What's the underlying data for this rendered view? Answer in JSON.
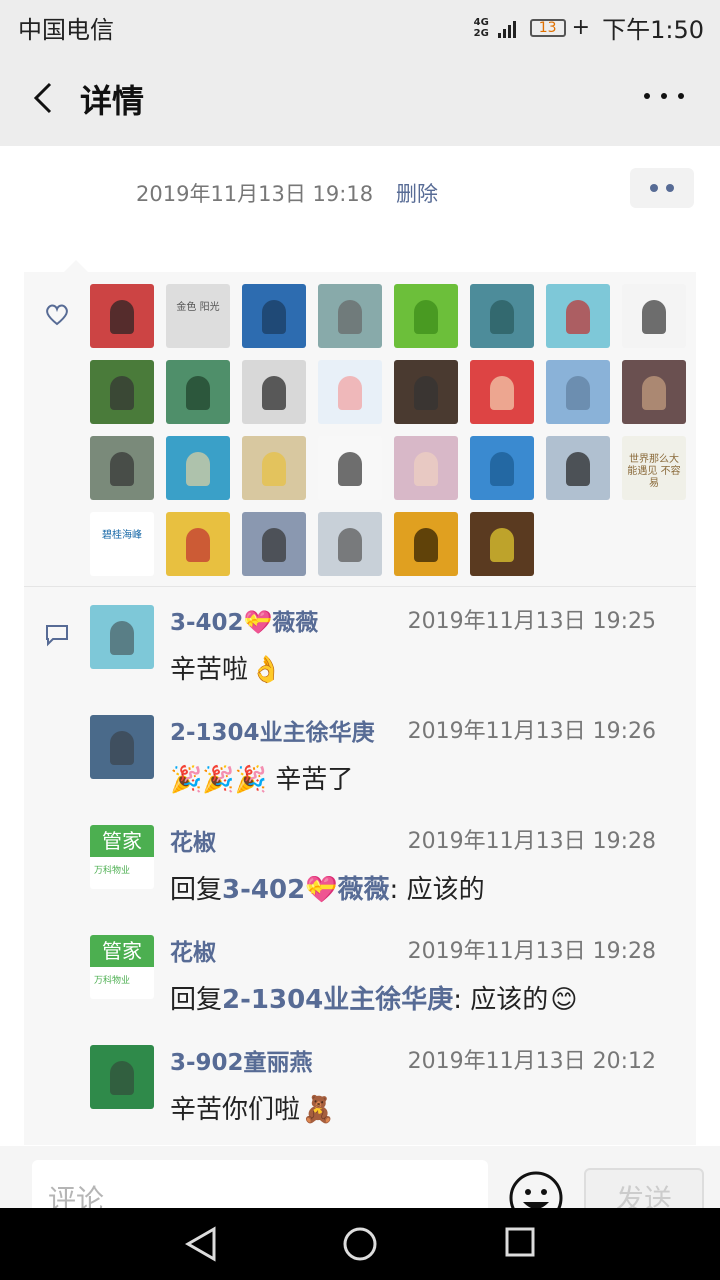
{
  "status": {
    "carrier": "中国电信",
    "net_top": "4G",
    "net_bot": "2G",
    "battery": "13",
    "time": "下午1:50"
  },
  "nav": {
    "title": "详情"
  },
  "post": {
    "time": "2019年11月13日 19:18",
    "delete": "删除"
  },
  "likes": {
    "avatars": [
      {
        "bg": "#c44",
        "fg": "#222",
        "kind": "plain"
      },
      {
        "bg": "#ddd",
        "fg": "#555",
        "kind": "text",
        "label": "金色 阳光"
      },
      {
        "bg": "#2d6cb0",
        "fg": "#1a3a5e",
        "kind": "plain"
      },
      {
        "bg": "#8aa",
        "fg": "#666",
        "kind": "plain"
      },
      {
        "bg": "#6cbf3a",
        "fg": "#3b8a18",
        "kind": "plain"
      },
      {
        "bg": "#4d8c9a",
        "fg": "#285a5c",
        "kind": "plain"
      },
      {
        "bg": "#7ec8d8",
        "fg": "#c03030",
        "kind": "plain"
      },
      {
        "bg": "#f4f4f4",
        "fg": "#333",
        "kind": "plain"
      },
      {
        "bg": "#4a7b3a",
        "fg": "#333",
        "kind": "plain"
      },
      {
        "bg": "#4f8f6a",
        "fg": "#1e3f2a",
        "kind": "plain"
      },
      {
        "bg": "#d8d8d8",
        "fg": "#222",
        "kind": "plain"
      },
      {
        "bg": "#e8f0f8",
        "fg": "#f2a0a0",
        "kind": "plain"
      },
      {
        "bg": "#4a3a30",
        "fg": "#333",
        "kind": "plain"
      },
      {
        "bg": "#d44",
        "fg": "#f3d0b0",
        "kind": "plain"
      },
      {
        "bg": "#8ab2d8",
        "fg": "#5f7fa0",
        "kind": "plain"
      },
      {
        "bg": "#6a5050",
        "fg": "#c8a080",
        "kind": "plain"
      },
      {
        "bg": "#7a8a7a",
        "fg": "#333",
        "kind": "plain"
      },
      {
        "bg": "#3aa0c8",
        "fg": "#e0d0a0",
        "kind": "plain"
      },
      {
        "bg": "#d8c8a0",
        "fg": "#e8c040",
        "kind": "plain"
      },
      {
        "bg": "#f8f8f8",
        "fg": "#333",
        "kind": "plain"
      },
      {
        "bg": "#d8b8c8",
        "fg": "#f0d0c0",
        "kind": "plain"
      },
      {
        "bg": "#3a8ad0",
        "fg": "#1a5a90",
        "kind": "plain"
      },
      {
        "bg": "#b0c0d0",
        "fg": "#222",
        "kind": "plain"
      },
      {
        "bg": "#f0f0e8",
        "fg": "#8a6a3a",
        "kind": "text",
        "label": "世界那么大 能遇见 不容易"
      },
      {
        "bg": "#fff",
        "fg": "#1a6aa8",
        "kind": "text",
        "label": "碧桂海峰"
      },
      {
        "bg": "#e8c040",
        "fg": "#c03030",
        "kind": "plain"
      },
      {
        "bg": "#8a98b0",
        "fg": "#333",
        "kind": "plain"
      },
      {
        "bg": "#c8d0d8",
        "fg": "#555",
        "kind": "plain"
      },
      {
        "bg": "#e0a020",
        "fg": "#2a1a00",
        "kind": "plain"
      },
      {
        "bg": "#5a3a20",
        "fg": "#e8d030",
        "kind": "plain"
      }
    ]
  },
  "comments": [
    {
      "name": "3-402💝薇薇",
      "time": "2019年11月13日 19:25",
      "text": "辛苦啦",
      "reply_prefix": "",
      "reply_to": "",
      "reply_sep": "",
      "emoji": "👌",
      "avatar": "#7ec8d8"
    },
    {
      "name": "2-1304业主徐华庚",
      "time": "2019年11月13日 19:26",
      "text": "🎉🎉🎉 辛苦了",
      "reply_prefix": "",
      "reply_to": "",
      "reply_sep": "",
      "emoji": "",
      "avatar": "#4a6a8a"
    },
    {
      "name": "花椒",
      "time": "2019年11月13日 19:28",
      "text": "应该的",
      "reply_prefix": "回复",
      "reply_to": "3-402💝薇薇",
      "reply_sep": ": ",
      "emoji": "",
      "avatar": "guanjia"
    },
    {
      "name": "花椒",
      "time": "2019年11月13日 19:28",
      "text": "应该的",
      "reply_prefix": "回复",
      "reply_to": "2-1304业主徐华庚",
      "reply_sep": ": ",
      "emoji": "😊",
      "avatar": "guanjia"
    },
    {
      "name": "3-902童丽燕",
      "time": "2019年11月13日 20:12",
      "text": "辛苦你们啦",
      "reply_prefix": "",
      "reply_to": "",
      "reply_sep": "",
      "emoji": "🧸",
      "avatar": "#2f8a4a"
    }
  ],
  "guanjia": {
    "top": "管家",
    "bottom": "万科物业"
  },
  "input": {
    "placeholder": "评论",
    "send": "发送"
  }
}
